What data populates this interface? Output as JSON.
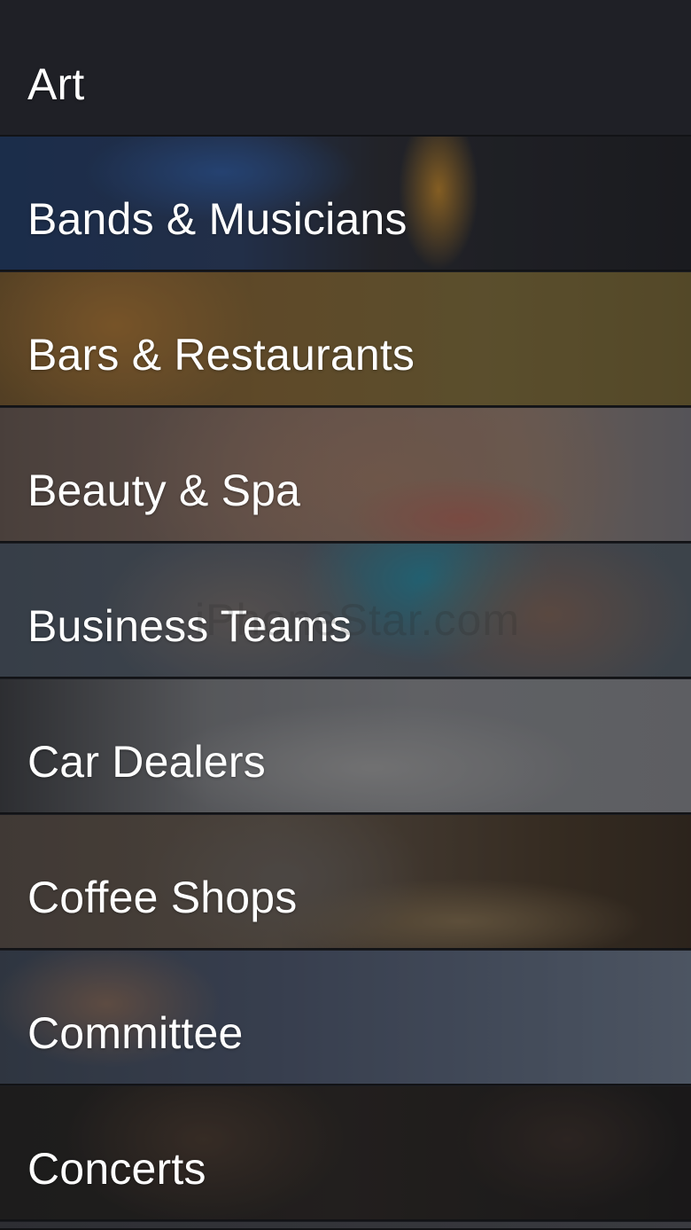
{
  "categories": [
    {
      "label": "Art"
    },
    {
      "label": "Bands & Musicians"
    },
    {
      "label": "Bars & Restaurants"
    },
    {
      "label": "Beauty & Spa"
    },
    {
      "label": "Business Teams"
    },
    {
      "label": "Car Dealers"
    },
    {
      "label": "Coffee Shops"
    },
    {
      "label": "Committee"
    },
    {
      "label": "Concerts"
    }
  ],
  "watermark": "iPhoneStar.com"
}
